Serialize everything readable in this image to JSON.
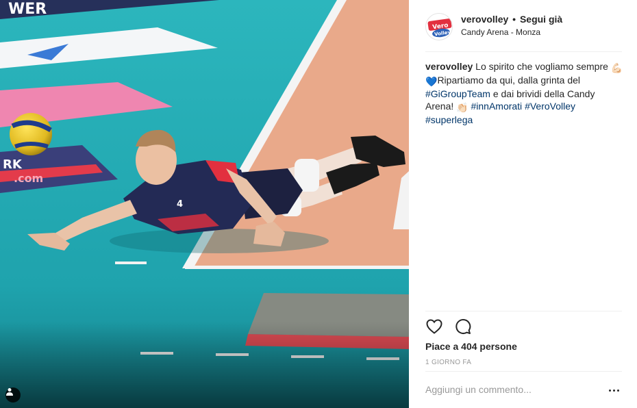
{
  "post": {
    "username": "verovolley",
    "separator": "•",
    "follow_label": "Segui già",
    "location": "Candy Arena - Monza",
    "avatar_text_top": "Vero",
    "avatar_text_bottom": "Volley",
    "caption": {
      "username": "verovolley",
      "text_1": " Lo spirito che vogliamo sempre ",
      "emoji_1": "💪🏻",
      "emoji_2": "💙",
      "text_2": "Ripartiamo da qui, dalla grinta del ",
      "hashtag_1": "#GiGroupTeam",
      "text_3": " e dai brividi della Candy Arena! ",
      "emoji_3": "👏🏻",
      "hashtag_2": "#innAmorati",
      "hashtag_3": "#VeroVolley",
      "hashtag_4": "#superlega"
    },
    "likes_text": "Piace a 404 persone",
    "time_text": "1 GIORNO FA",
    "comment_placeholder": "Aggiungi un commento..."
  },
  "photo": {
    "floor_text_1": "WER",
    "floor_text_2": "RK",
    "floor_text_3": ".com",
    "jersey_number": "4"
  },
  "icons": {
    "like": "heart-icon",
    "comment": "comment-icon",
    "more": "more-options-icon",
    "tag": "user-tag-icon"
  },
  "colors": {
    "court_teal": "#27b0b8",
    "court_peach": "#e9a98a",
    "link_blue": "#003569",
    "text": "#262626",
    "muted": "#999999"
  }
}
